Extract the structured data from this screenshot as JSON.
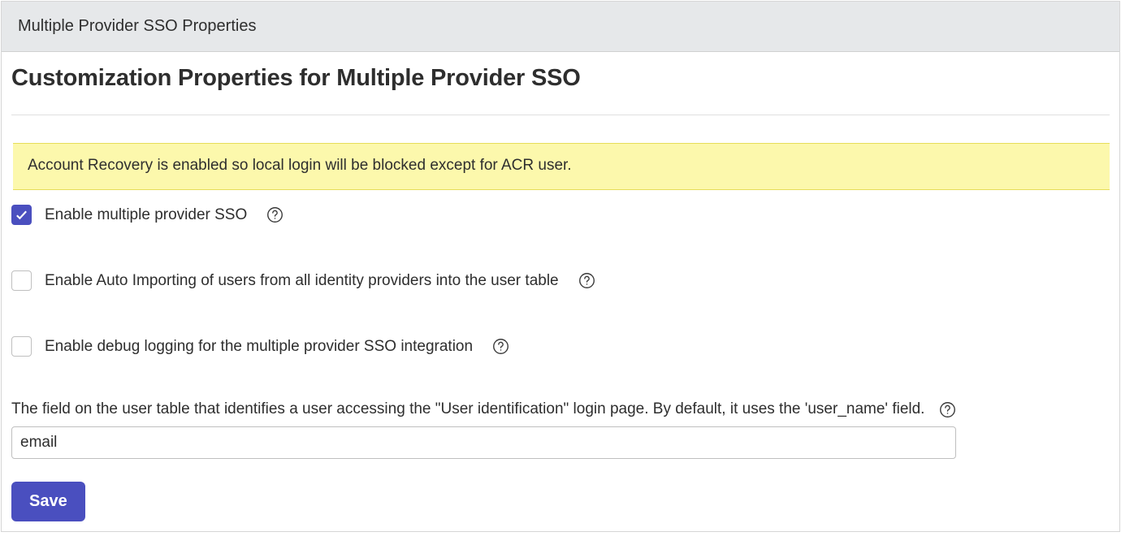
{
  "header": {
    "title": "Multiple Provider SSO Properties"
  },
  "main": {
    "title": "Customization Properties for Multiple Provider SSO",
    "alert": "Account Recovery is enabled so local login will be blocked except for ACR user.",
    "fields": {
      "enable_sso": {
        "label": "Enable multiple provider SSO",
        "checked": true
      },
      "enable_auto_import": {
        "label": "Enable Auto Importing of users from all identity providers into the user table",
        "checked": false
      },
      "enable_debug": {
        "label": "Enable debug logging for the multiple provider SSO integration",
        "checked": false
      },
      "user_field": {
        "label": "The field on the user table that identifies a user accessing the \"User identification\" login page. By default, it uses the 'user_name' field.",
        "value": "email"
      }
    },
    "save_label": "Save"
  }
}
